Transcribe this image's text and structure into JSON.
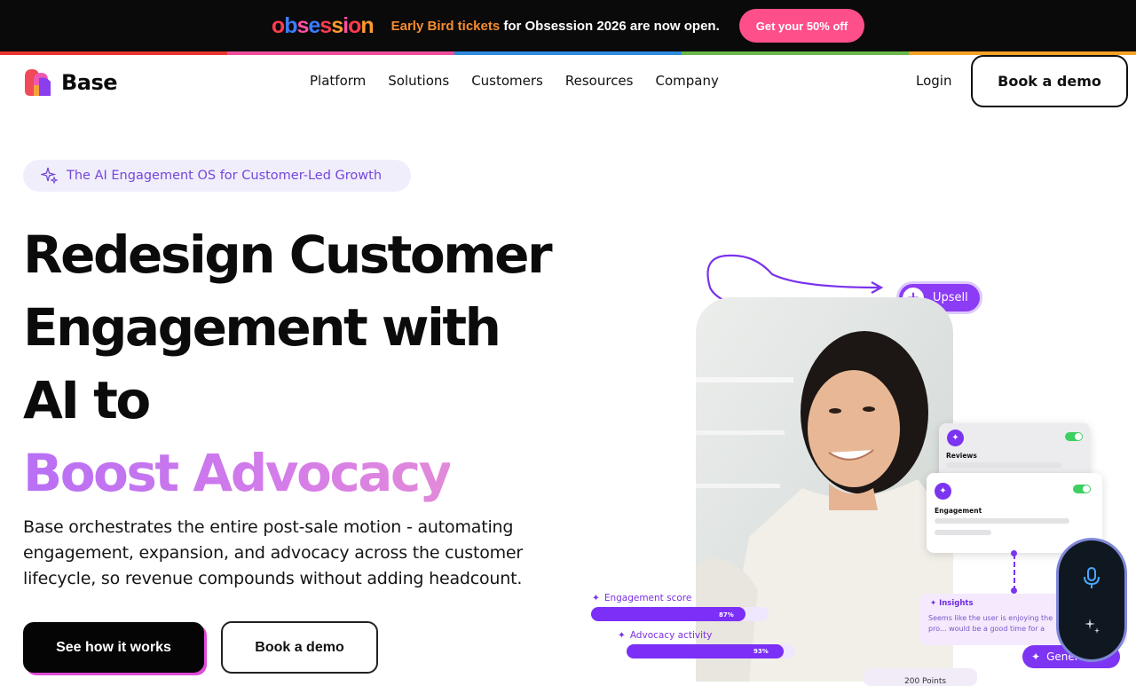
{
  "announcement": {
    "event_logo_text": "obsession",
    "event_logo_letters": [
      "o",
      "b",
      "s",
      "e",
      "s",
      "s",
      "i",
      "o",
      "n"
    ],
    "event_logo_colors": [
      "#ff3b4f",
      "#3d7cff",
      "#ff4fa3",
      "#3d7cff",
      "#ff3b4f",
      "#ff9a2e",
      "#ff4fa3",
      "#ff3b4f",
      "#ff9a2e"
    ],
    "highlight_text": "Early Bird tickets",
    "rest_text": " for Obsession 2026 are now open.",
    "button_label": "Get your 50% off",
    "rainbow_colors": [
      "#e8352e",
      "#ee4d9b",
      "#2f8be0",
      "#6ab84d",
      "#f4a227"
    ]
  },
  "header": {
    "brand_name": "Base",
    "nav": [
      "Platform",
      "Solutions",
      "Customers",
      "Resources",
      "Company"
    ],
    "login_label": "Login",
    "demo_label": "Book a demo"
  },
  "hero": {
    "tagline": "The AI Engagement OS for Customer-Led Growth",
    "headline_line1": "Redesign Customer",
    "headline_line2": "Engagement with",
    "headline_line3": "AI to",
    "headline_highlight": "Boost Advocacy",
    "subtext": "Base orchestrates the entire post-sale motion - automating engagement, expansion, and advocacy across the customer lifecycle, so revenue compounds without adding headcount.",
    "primary_cta": "See how it works",
    "secondary_cta": "Book a demo"
  },
  "visual": {
    "upsell_label": "Upsell",
    "reviews_label": "Reviews",
    "engagement_label": "Engagement",
    "engagement_score_label": "Engagement score",
    "engagement_score_value": "87%",
    "engagement_score_fraction": 0.87,
    "advocacy_activity_label": "Advocacy activity",
    "advocacy_activity_value": "93%",
    "advocacy_activity_fraction": 0.93,
    "insights_title": "Insights",
    "insights_text": "Seems like the user is enjoying the pro... would be a good time for a testimonia...",
    "generate_label": "Genera...",
    "points_label": "200 Points",
    "accent_color": "#7b2ff7"
  }
}
